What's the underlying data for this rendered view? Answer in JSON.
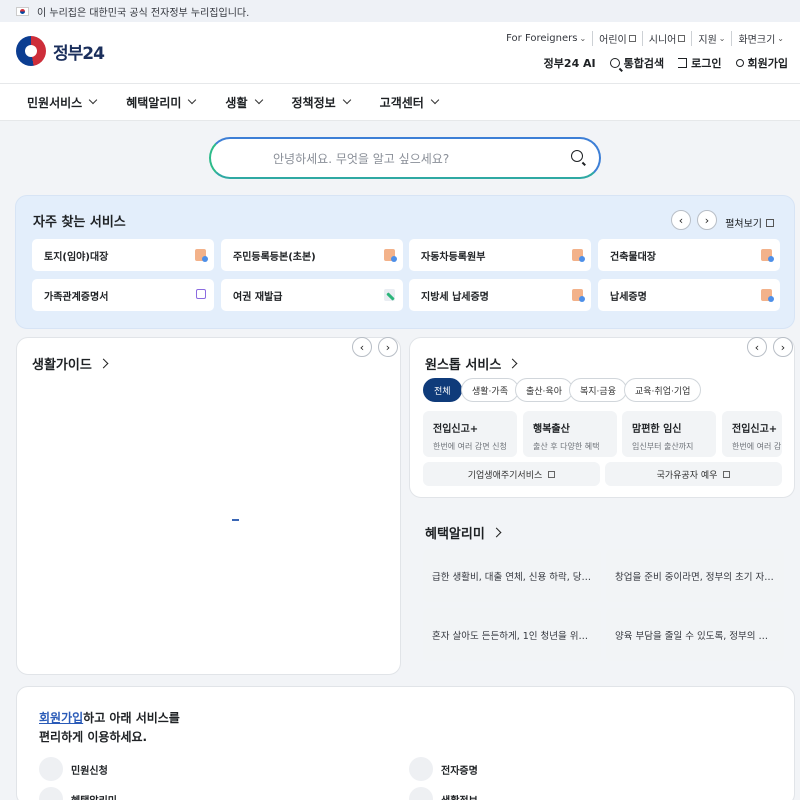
{
  "gov_banner": {
    "text": "이 누리집은 대한민국 공식 전자정부 누리집입니다."
  },
  "logo": {
    "text": "정부24"
  },
  "util_links": [
    {
      "label": "For Foreigners"
    },
    {
      "label": "어린이"
    },
    {
      "label": "시니어"
    },
    {
      "label": "지원"
    },
    {
      "label": "화면크기"
    }
  ],
  "actions": {
    "ai": "정부24 AI",
    "search": "통합검색",
    "login": "로그인",
    "signup": "회원가입"
  },
  "nav": [
    "민원서비스",
    "혜택알리미",
    "생활",
    "정책정보",
    "고객센터"
  ],
  "search": {
    "placeholder": "안녕하세요. 무엇을 알고 싶으세요?"
  },
  "favorites": {
    "title": "자주 찾는 서비스",
    "view_all": "펼쳐보기",
    "items": [
      {
        "label": "토지(임야)대장",
        "icon": "document-icon"
      },
      {
        "label": "주민등록등본(초본)",
        "icon": "document-icon"
      },
      {
        "label": "자동차등록원부",
        "icon": "document-icon"
      },
      {
        "label": "건축물대장",
        "icon": "document-icon"
      },
      {
        "label": "가족관계증명서",
        "icon": "external-link-icon"
      },
      {
        "label": "여권 재발급",
        "icon": "pen-icon"
      },
      {
        "label": "지방세 납세증명",
        "icon": "document-icon"
      },
      {
        "label": "납세증명",
        "icon": "document-icon"
      }
    ]
  },
  "life_guide": {
    "title": "생활가이드"
  },
  "onestop": {
    "title": "원스톱 서비스",
    "chips": [
      "전체",
      "생활·가족",
      "출산·육아",
      "복지·금융",
      "교육·취업·기업"
    ],
    "cards": [
      {
        "title": "전입신고+",
        "desc": "한번에 여러 감면 신청"
      },
      {
        "title": "행복출산",
        "desc": "출산 후 다양한 혜택"
      },
      {
        "title": "맘편한 임신",
        "desc": "임신부터 출산까지"
      },
      {
        "title": "전입신고+",
        "desc": "한번에 여러 감"
      }
    ],
    "links": [
      "기업생애주기서비스",
      "국가유공자 예우"
    ]
  },
  "benefits": {
    "title": "혜택알리미",
    "cards": [
      "급한 생활비, 대출 연체, 신용 하락, 당…",
      "창업을 준비 중이라면, 정부의 초기 자…",
      "혼자 살아도 든든하게, 1인 청년을 위…",
      "양육 부담을 줄일 수 있도록, 정부의 …"
    ]
  },
  "member": {
    "highlight": "회원가입",
    "line1_rest": "하고 아래 서비스를",
    "line2": "편리하게 이용하세요.",
    "items": [
      "민원신청",
      "전자증명",
      "혜택알리미",
      "생활정보"
    ]
  }
}
